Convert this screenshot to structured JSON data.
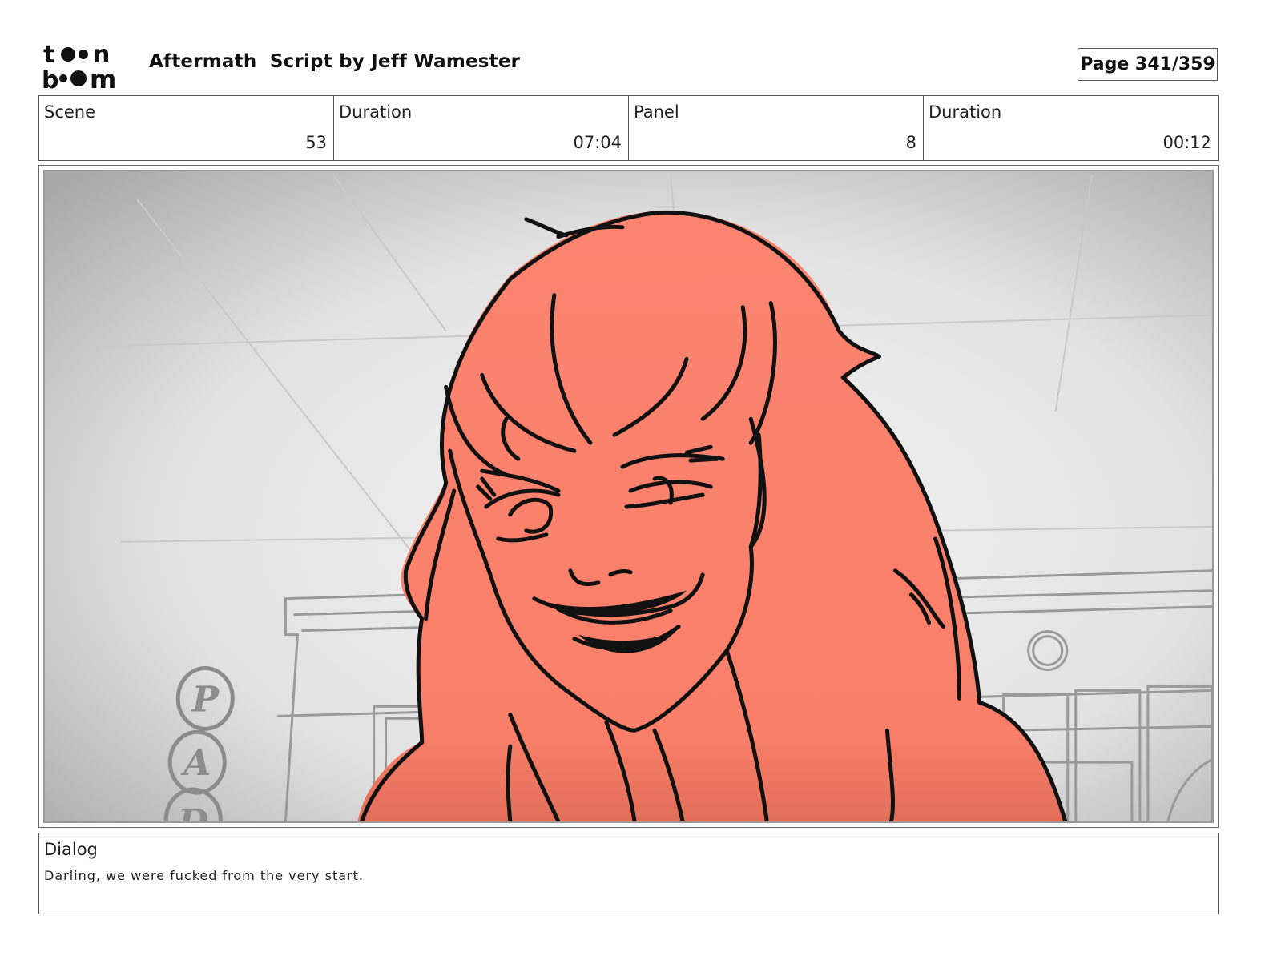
{
  "header": {
    "logo_text": "toonboom",
    "title": "Aftermath  Script by Jeff Wamester",
    "page": "Page 341/359"
  },
  "info": {
    "scene_label": "Scene",
    "scene_value": "53",
    "scene_duration_label": "Duration",
    "scene_duration_value": "07:04",
    "panel_label": "Panel",
    "panel_value": "8",
    "panel_duration_label": "Duration",
    "panel_duration_value": "00:12"
  },
  "dialog": {
    "label": "Dialog",
    "text": "Darling, we were fucked from the very start."
  },
  "sign_letters": [
    "P",
    "A",
    "D"
  ],
  "colors": {
    "hair_fill": "#f98069",
    "line": "#111111",
    "background": "#e4e4e4"
  }
}
